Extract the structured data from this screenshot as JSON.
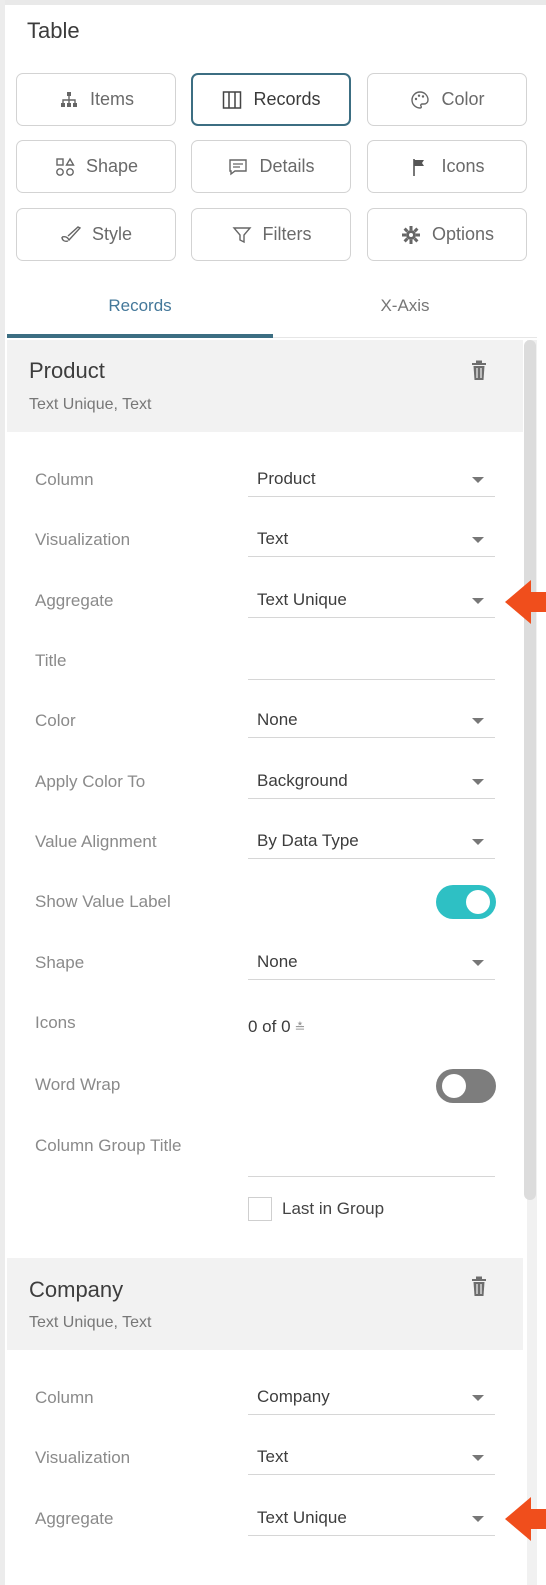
{
  "panel": {
    "title": "Table"
  },
  "buttons": [
    {
      "label": "Items",
      "icon": "hierarchy-icon",
      "active": false
    },
    {
      "label": "Records",
      "icon": "columns-icon",
      "active": true
    },
    {
      "label": "Color",
      "icon": "palette-icon",
      "active": false
    },
    {
      "label": "Shape",
      "icon": "shapes-icon",
      "active": false
    },
    {
      "label": "Details",
      "icon": "message-icon",
      "active": false
    },
    {
      "label": "Icons",
      "icon": "flag-icon",
      "active": false
    },
    {
      "label": "Style",
      "icon": "brush-icon",
      "active": false
    },
    {
      "label": "Filters",
      "icon": "funnel-icon",
      "active": false
    },
    {
      "label": "Options",
      "icon": "gear-icon",
      "active": false
    }
  ],
  "tabs": [
    {
      "label": "Records",
      "active": true
    },
    {
      "label": "X-Axis",
      "active": false
    }
  ],
  "cards": [
    {
      "name": "Product",
      "subtitle": "Text Unique, Text",
      "fields": {
        "column": {
          "label": "Column",
          "value": "Product"
        },
        "visualization": {
          "label": "Visualization",
          "value": "Text"
        },
        "aggregate": {
          "label": "Aggregate",
          "value": "Text Unique"
        },
        "title": {
          "label": "Title",
          "value": ""
        },
        "color": {
          "label": "Color",
          "value": "None"
        },
        "apply_color_to": {
          "label": "Apply Color To",
          "value": "Background"
        },
        "value_alignment": {
          "label": "Value Alignment",
          "value": "By Data Type"
        },
        "show_value_label": {
          "label": "Show Value Label",
          "on": true
        },
        "shape": {
          "label": "Shape",
          "value": "None"
        },
        "icons": {
          "label": "Icons",
          "value": "0 of 0"
        },
        "word_wrap": {
          "label": "Word Wrap",
          "on": false
        },
        "column_group_title": {
          "label": "Column Group Title",
          "value": ""
        },
        "last_in_group": {
          "label": "Last in Group",
          "checked": false
        }
      }
    },
    {
      "name": "Company",
      "subtitle": "Text Unique, Text",
      "fields": {
        "column": {
          "label": "Column",
          "value": "Company"
        },
        "visualization": {
          "label": "Visualization",
          "value": "Text"
        },
        "aggregate": {
          "label": "Aggregate",
          "value": "Text Unique"
        }
      }
    }
  ],
  "colors": {
    "accent": "#3c6e82",
    "toggle_on": "#2ec0c4",
    "toggle_off": "#7d7d7d",
    "callout_arrow": "#f04e1c"
  }
}
